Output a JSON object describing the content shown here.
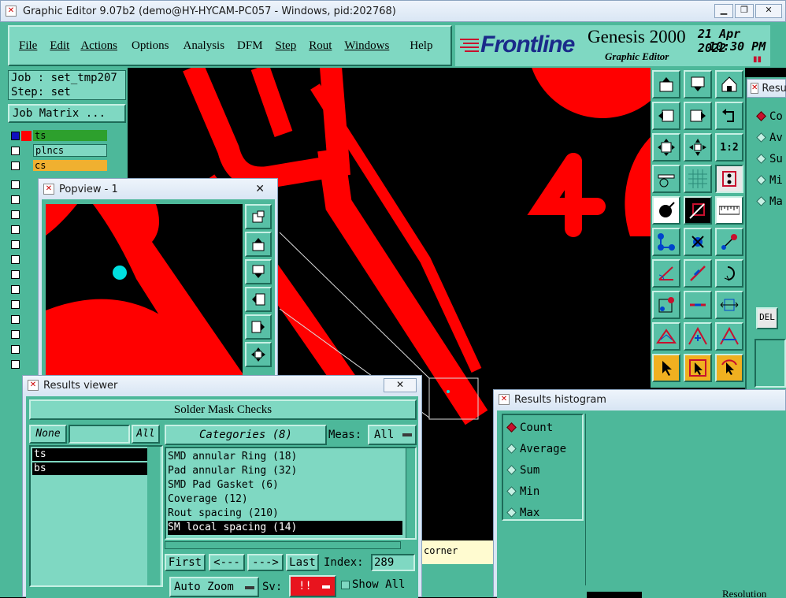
{
  "title_bar": {
    "title": "Graphic Editor 9.07b2 (demo@HY-HYCAM-PC057 - Windows, pid:202768)"
  },
  "menu": [
    "File",
    "Edit",
    "Actions",
    "Options",
    "Analysis",
    "DFM",
    "Step",
    "Rout",
    "Windows",
    "Help"
  ],
  "brand": {
    "logo": "Frontline",
    "product": "Genesis 2000",
    "subtitle": "Graphic Editor",
    "date": "21 Apr 2022",
    "time": "10:30 PM"
  },
  "job": {
    "job_label": "Job : set_tmp207",
    "step_label": "Step: set",
    "job_matrix": "Job Matrix ..."
  },
  "layers": [
    {
      "name": "ts",
      "color": "#2da02d"
    },
    {
      "name": "plncs",
      "color": "#7fd8c2"
    },
    {
      "name": "cs",
      "color": "#f0b030"
    }
  ],
  "canvas": {
    "big_text": "4",
    "colors": {
      "copper": "#ff0000",
      "background": "#000000",
      "marker": "#00e0e0"
    }
  },
  "popview": {
    "title": "Popview - 1"
  },
  "results_viewer": {
    "title": "Results viewer",
    "heading": "Solder Mask Checks",
    "none": "None",
    "all": "All",
    "categories_label": "Categories (8)",
    "meas_label": "Meas:",
    "meas_value": "All",
    "layers": [
      "ts",
      "bs"
    ],
    "categories": [
      "SMD annular Ring (18)",
      "Pad annular Ring (32)",
      "SMD Pad Gasket (6)",
      "Coverage (12)",
      "Rout spacing (210)",
      "SM local spacing (14)"
    ],
    "selected_category": 5,
    "nav": {
      "first": "First",
      "prev": "<---",
      "next": "--->",
      "last": "Last",
      "index_label": "Index:",
      "index_value": "289"
    },
    "auto_zoom": "Auto Zoom",
    "sv_label": "Sv:",
    "sv_value": "!!",
    "show_all": "Show All"
  },
  "status_text": "corner",
  "results_histogram": {
    "title": "Results histogram",
    "options": [
      "Count",
      "Average",
      "Sum",
      "Min",
      "Max"
    ],
    "selected": 0,
    "bottom_label": "Resolution"
  },
  "right_panel": {
    "title": "Resu",
    "options": [
      "Co",
      "Av",
      "Su",
      "Mi",
      "Ma"
    ],
    "selected": 0,
    "del": "DEL"
  }
}
